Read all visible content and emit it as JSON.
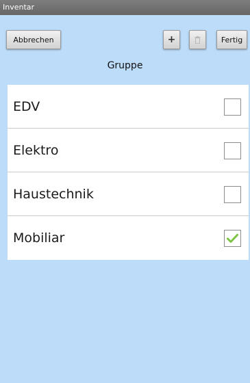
{
  "window": {
    "title": "Inventar"
  },
  "toolbar": {
    "cancel_label": "Abbrechen",
    "add_label": "+",
    "delete_icon": "trash-icon",
    "done_label": "Fertig"
  },
  "header": {
    "title": "Gruppe"
  },
  "list": {
    "items": [
      {
        "label": "EDV",
        "checked": false
      },
      {
        "label": "Elektro",
        "checked": false
      },
      {
        "label": "Haustechnik",
        "checked": false
      },
      {
        "label": "Mobiliar",
        "checked": true
      }
    ]
  },
  "colors": {
    "background": "#bcdcfa",
    "checkmark": "#7cc443"
  }
}
